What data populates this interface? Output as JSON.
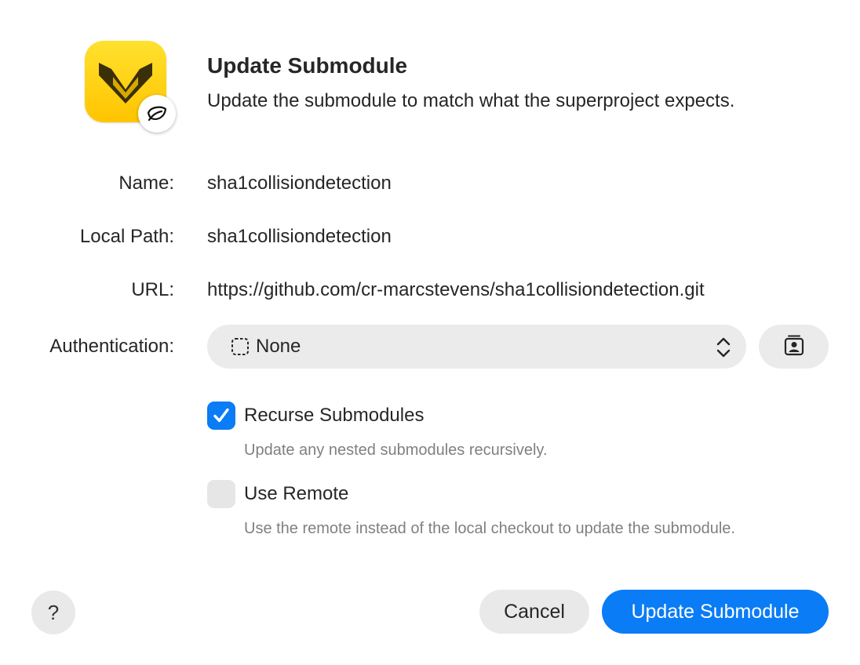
{
  "dialog": {
    "title": "Update Submodule",
    "subtitle": "Update the submodule to match what the superproject expects."
  },
  "icons": {
    "app": "app-logo-icon",
    "badge": "leaf-icon",
    "auth": "dashed-square-icon",
    "chevron": "up-down-chevron-icon",
    "key": "keychain-icon",
    "check": "checkmark-icon"
  },
  "fields": {
    "name_label": "Name:",
    "name_value": "sha1collisiondetection",
    "path_label": "Local Path:",
    "path_value": "sha1collisiondetection",
    "url_label": "URL:",
    "url_value": "https://github.com/cr-marcstevens/sha1collisiondetection.git",
    "auth_label": "Authentication:",
    "auth_value": "None"
  },
  "options": {
    "recurse": {
      "label": "Recurse Submodules",
      "description": "Update any nested submodules recursively.",
      "checked": true
    },
    "remote": {
      "label": "Use Remote",
      "description": "Use the remote instead of the local checkout to update the submodule.",
      "checked": false
    }
  },
  "buttons": {
    "help": "?",
    "cancel": "Cancel",
    "primary": "Update Submodule"
  },
  "colors": {
    "accent": "#0a7cf5",
    "icon_yellow": "#ffd400",
    "control_gray": "#ebebeb"
  }
}
